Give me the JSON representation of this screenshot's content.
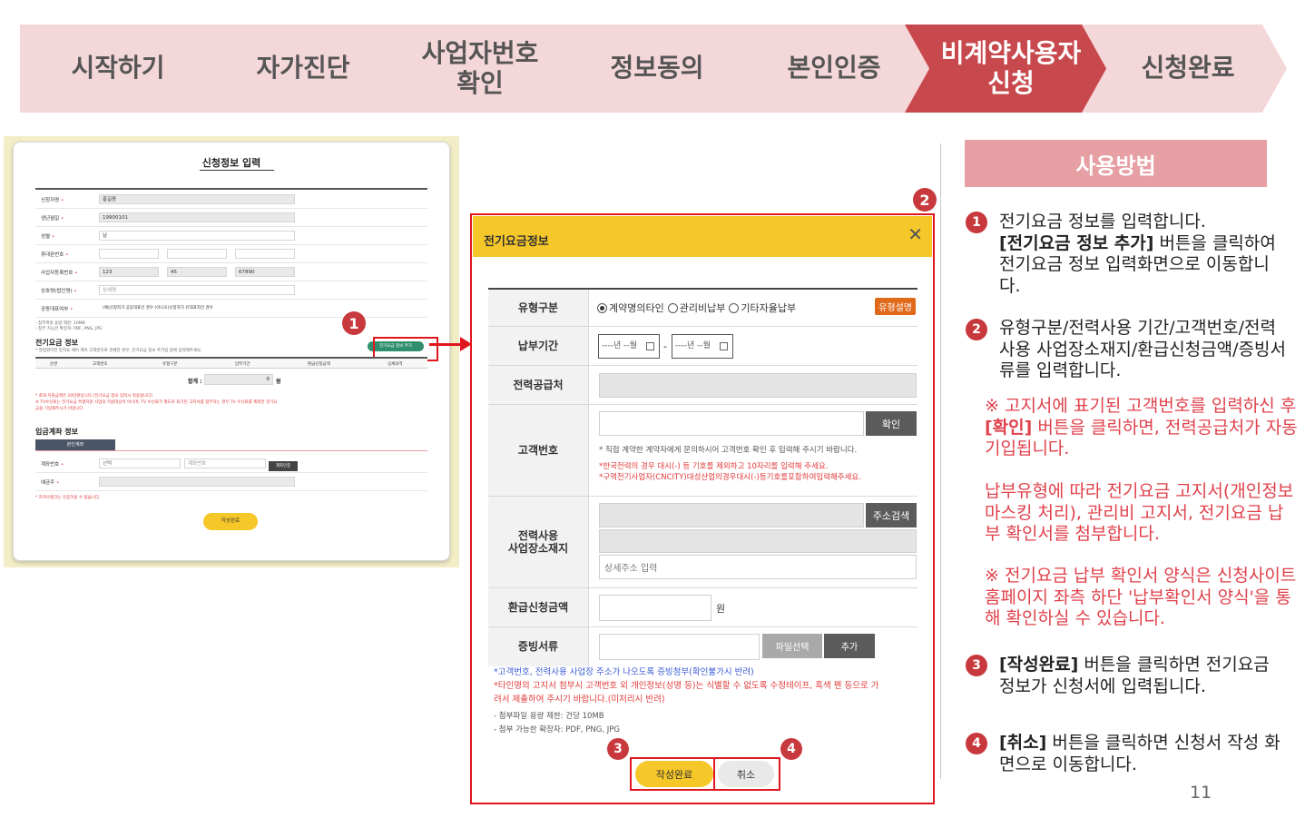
{
  "steps": [
    {
      "label": "시작하기"
    },
    {
      "label": "자가진단"
    },
    {
      "label": "사업자번호\n확인"
    },
    {
      "label": "정보동의"
    },
    {
      "label": "본인인증"
    },
    {
      "label": "비계약사용자\n신청"
    },
    {
      "label": "신청완료"
    }
  ],
  "colors": {
    "step": "#f4d7d9",
    "step_active": "#c8494d",
    "accent_yellow": "#f6c728",
    "highlight_red": "#e0161e",
    "badge": "#c8393d"
  },
  "mini_form": {
    "title": "신청정보 입력",
    "fields": [
      {
        "label": "신청자명",
        "value": "홍길동"
      },
      {
        "label": "생년월일",
        "value": "19900101"
      },
      {
        "label": "성별",
        "value": "남"
      },
      {
        "label": "휴대폰번호",
        "value": ""
      },
      {
        "label": "사업자등록번호",
        "v1": "123",
        "v2": "45",
        "v3": "67890"
      },
      {
        "label": "상호명(법인명)",
        "value": "상세명"
      },
      {
        "label": "공동대표여부",
        "value": "(예)신청자가 공동대표인 경우 (아니오)신청자가 유대표자인 경우"
      }
    ],
    "notes": [
      "- 첨부파일 용량 제한: 10MB",
      "- 첨부 가능한 확장자: PDF, PNG, JPG"
    ],
    "electric_title": "전기요금 정보",
    "electric_desc": "* 영업외이전 일자요 에어 계이 고객번호로 분배한 경우, 전기요금 정보 추가입 중에 입력해주세요.",
    "add_button": "전기요금 정보 추가",
    "table_headers": [
      "순번",
      "고객번호",
      "유형구분",
      "납부기간",
      "환급신청금액",
      "상세내역"
    ],
    "total_label": "합계 :",
    "total_value": "0",
    "total_unit": "원",
    "red_notes": [
      "* 최대 지원금액은 20만원입니다.(전기요금 정보 입력시 적용됩니다)",
      "※ TV수신료는 전기요금 특별지원 사업의 지원대상이 아니며, TV 수신료가 별도로 표기된 고지서를 첨부하는 경우 TV 수신료를 제외한 전기요",
      "금을 기입해주시기 바랍니다."
    ],
    "bank_title": "입금계좌 정보",
    "bank_tab": "본인계좌",
    "bank_label": "계좌번호",
    "bank_select": "선택",
    "bank_placeholder": "계좌번호",
    "bank_btn": "계좌인증",
    "holder_label": "예금주",
    "bank_note": "* 카카오뱅크는 인증하실 수 없습니다.",
    "submit": "작성완료"
  },
  "badges": {
    "b1": "1",
    "b2": "2",
    "b3": "3",
    "b4": "4"
  },
  "modal": {
    "title": "전기요금정보",
    "close": "✕",
    "type_label": "유형구분",
    "type_options": [
      "계약명의타인",
      "관리비납부",
      "기타자율납부"
    ],
    "type_selected": "계약명의타인",
    "type_help": "유형설명",
    "period_label": "납부기간",
    "period_from": "----년 --월",
    "period_to": "----년 --월",
    "period_sep": "-",
    "supplier_label": "전력공급처",
    "customer_label": "고객번호",
    "confirm_btn": "확인",
    "customer_help": "* 직접 계약한 계약자에게 문의하시어 고객번호 확인 후 입력해 주시기 바랍니다.",
    "customer_red1": "*한국전력의 경우 대시(-) 등 기호를 제외하고 10자리를 입력해 주세요.",
    "customer_red2": "*구역전기사업자(CNCITY)대성산업의경우대시(-)등기호를포함하여입력해주세요.",
    "address_label": "전력사용\n사업장소재지",
    "address_btn": "주소검색",
    "address_detail": "상세주소 입력",
    "refund_label": "환급신청금액",
    "refund_unit": "원",
    "proof_label": "증빙서류",
    "file_btn": "파일선택",
    "add_btn": "추가",
    "note1": "*고객번호, 전력사용 사업장 주소가 나오도록 증빙첨부(확인불가시 반려)",
    "note2": "*타인명의 고지서 첨부시 고객번호 외 개인정보(성명 등)는 식별할 수 없도록 수정테이프, 흑색 펜 등으로 가",
    "note3": "려서 제출하여 주시기 바랍니다.(미처리시 반려)",
    "note4": "- 첨부파일 용량 제한: 건당 10MB",
    "note5": "- 첨부 가능한 확장자: PDF, PNG, JPG",
    "submit": "작성완료",
    "cancel": "취소"
  },
  "howto": {
    "title": "사용방법",
    "step1": {
      "text": "전기요금 정보를 입력합니다.",
      "bold": "[전기요금 정보 추가]",
      "rest": " 버튼을 클릭하여 전기요금 정보 입력화면으로 이동합니다."
    },
    "step2": {
      "text": "유형구분/전력사용 기간/고객번호/전력사용 사업장소재지/환급신청금액/증빙서류를 입력합니다."
    },
    "note_a": {
      "pre": "※ 고지서에 표기된 고객번호를 입력하신 후 ",
      "bold": "[확인]",
      "post": " 버튼을 클릭하면, 전력공급처가 자동 기입됩니다."
    },
    "note_b": "납부유형에 따라 전기요금 고지서(개인정보 마스킹 처리), 관리비 고지서, 전기요금 납부 확인서를 첨부합니다.",
    "note_c": "※ 전기요금 납부 확인서 양식은 신청사이트 홈페이지 좌측 하단 '납부확인서 양식'을 통해 확인하실 수 있습니다.",
    "step3": {
      "bold": "[작성완료]",
      "rest": " 버튼을 클릭하면 전기요금 정보가 신청서에 입력됩니다."
    },
    "step4": {
      "bold": "[취소]",
      "rest": " 버튼을 클릭하면 신청서 작성 화면으로 이동합니다."
    }
  },
  "page_number": "11"
}
